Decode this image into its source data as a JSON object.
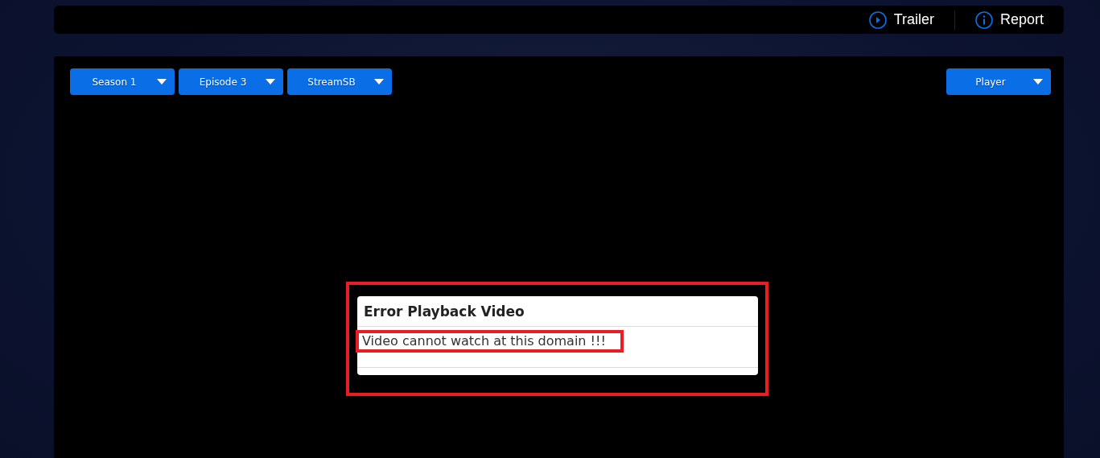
{
  "top_links": [
    {
      "kind": "play",
      "label": "Trailer"
    },
    {
      "kind": "info",
      "label": "Report"
    }
  ],
  "selectors": [
    {
      "label": "Season 1"
    },
    {
      "label": "Episode 3"
    },
    {
      "label": "StreamSB"
    }
  ],
  "player_selector": {
    "label": "Player"
  },
  "dialog": {
    "title": "Error Playback Video",
    "message": "Video cannot watch at this domain !!!"
  }
}
